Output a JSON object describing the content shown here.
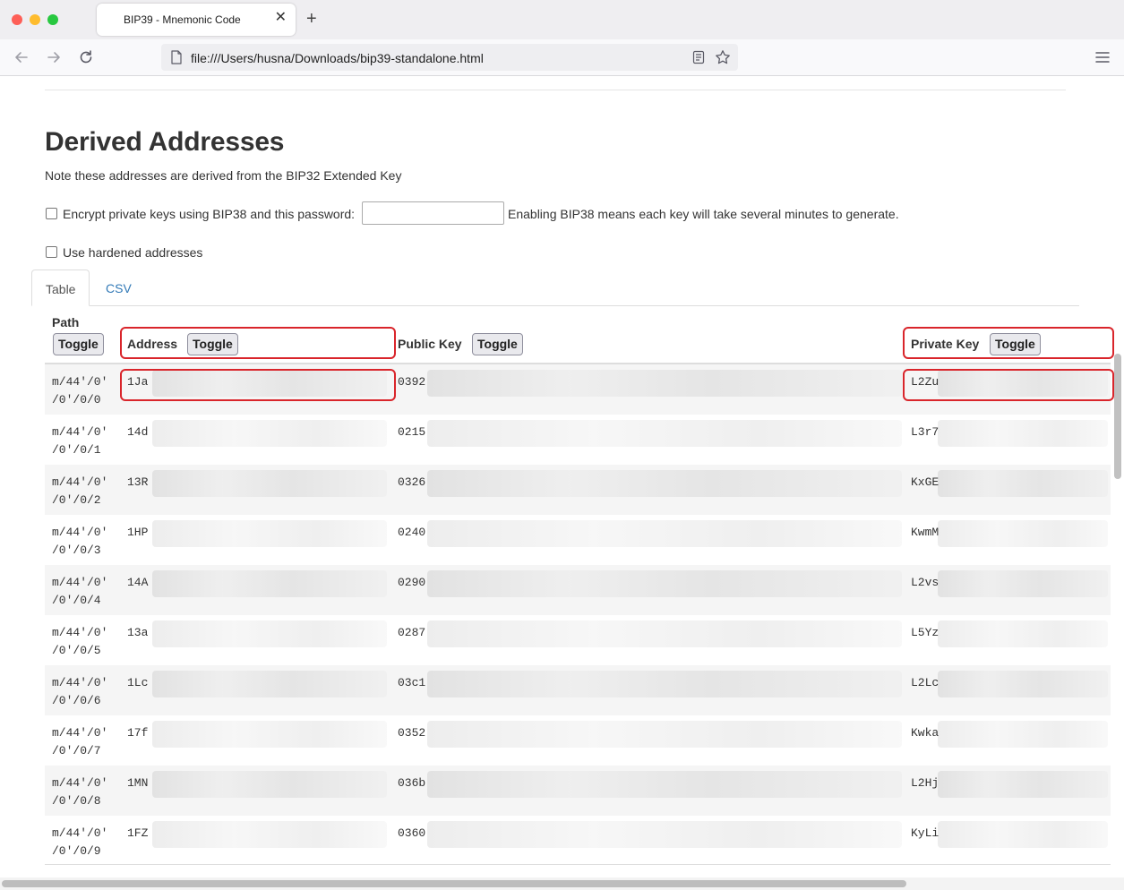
{
  "browser": {
    "tab_title": "BIP39 - Mnemonic Code",
    "tab_close": "✕",
    "new_tab": "+",
    "url": "file:///Users/husna/Downloads/bip39-standalone.html"
  },
  "section": {
    "title": "Derived Addresses",
    "note": "Note these addresses are derived from the BIP32 Extended Key"
  },
  "options": {
    "bip38_label": "Encrypt private keys using BIP38 and this password:",
    "bip38_password": "",
    "bip38_hint": "Enabling BIP38 means each key will take several minutes to generate.",
    "hardened_label": "Use hardened addresses"
  },
  "tabs": {
    "table": "Table",
    "csv": "CSV"
  },
  "table": {
    "headers": {
      "path": "Path",
      "address": "Address",
      "public_key": "Public Key",
      "private_key": "Private Key",
      "toggle": "Toggle"
    },
    "rows": [
      {
        "path_a": "m/44'/0'",
        "path_b": "/0'/0/0",
        "address": "1Ja",
        "pubkey": "0392",
        "privkey": "L2Zu"
      },
      {
        "path_a": "m/44'/0'",
        "path_b": "/0'/0/1",
        "address": "14d",
        "pubkey": "0215",
        "privkey": "L3r7"
      },
      {
        "path_a": "m/44'/0'",
        "path_b": "/0'/0/2",
        "address": "13R",
        "pubkey": "0326",
        "privkey": "KxGE"
      },
      {
        "path_a": "m/44'/0'",
        "path_b": "/0'/0/3",
        "address": "1HP",
        "pubkey": "0240",
        "privkey": "KwmM"
      },
      {
        "path_a": "m/44'/0'",
        "path_b": "/0'/0/4",
        "address": "14A",
        "pubkey": "0290",
        "privkey": "L2vs"
      },
      {
        "path_a": "m/44'/0'",
        "path_b": "/0'/0/5",
        "address": "13a",
        "pubkey": "0287",
        "privkey": "L5Yz"
      },
      {
        "path_a": "m/44'/0'",
        "path_b": "/0'/0/6",
        "address": "1Lc",
        "pubkey": "03c1",
        "privkey": "L2Lc"
      },
      {
        "path_a": "m/44'/0'",
        "path_b": "/0'/0/7",
        "address": "17f",
        "pubkey": "0352",
        "privkey": "Kwka"
      },
      {
        "path_a": "m/44'/0'",
        "path_b": "/0'/0/8",
        "address": "1MN",
        "pubkey": "036b",
        "privkey": "L2Hj"
      },
      {
        "path_a": "m/44'/0'",
        "path_b": "/0'/0/9",
        "address": "1FZ",
        "pubkey": "0360",
        "privkey": "KyLi"
      }
    ]
  },
  "colors": {
    "highlight": "#d9252b",
    "link": "#337ab7"
  }
}
